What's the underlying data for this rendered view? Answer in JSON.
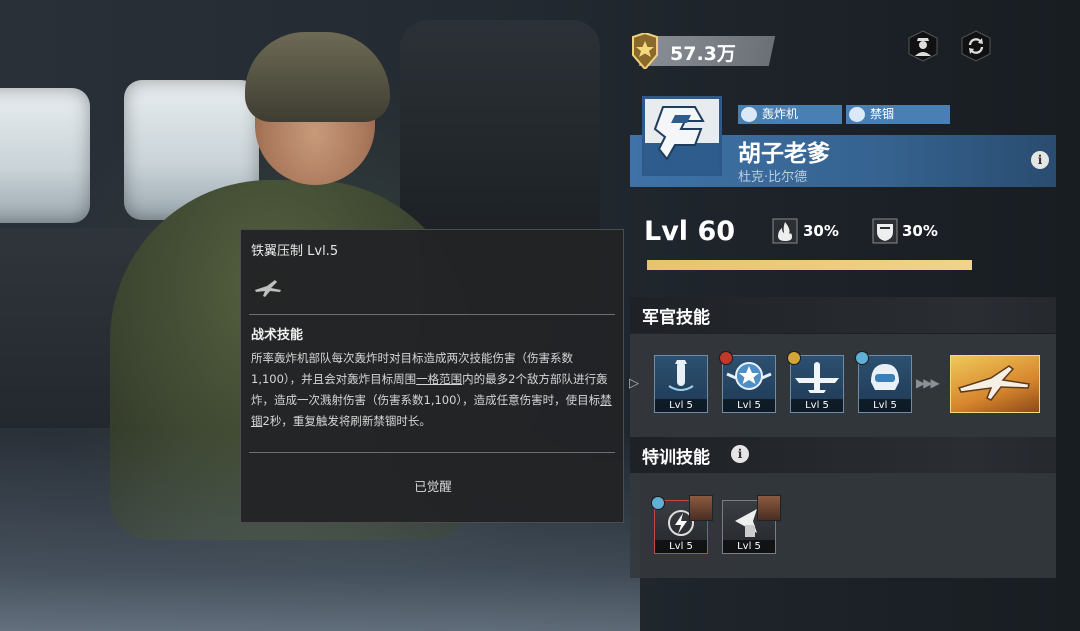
{
  "currency": {
    "amount": "57.3万"
  },
  "officer": {
    "tags": [
      "轰炸机",
      "禁锢"
    ],
    "name": "胡子老爹",
    "subname": "杜克·比尔德",
    "level": "Lvl 60",
    "stat1": "30%",
    "stat2": "30%",
    "xp_fraction": 1.0
  },
  "sections": {
    "officer_skills": "军官技能",
    "training_skills": "特训技能"
  },
  "skills": [
    {
      "level": "Lvl 5",
      "icon": "bomb-icon"
    },
    {
      "level": "Lvl 5",
      "icon": "star-wings-icon"
    },
    {
      "level": "Lvl 5",
      "icon": "plane-icon"
    },
    {
      "level": "Lvl 5",
      "icon": "pilot-helmet-icon"
    }
  ],
  "training": [
    {
      "level": "Lvl 5",
      "icon": "lightning-icon"
    },
    {
      "level": "Lvl 5",
      "icon": "shield-plane-icon"
    }
  ],
  "tooltip": {
    "title": "铁翼压制 Lvl.5",
    "section": "战术技能",
    "desc_part1": "所率轰炸机部队每次轰炸时对目标造成两次技能伤害（伤害系数1,100），并且会对轰炸目标周围",
    "desc_ul1": "一格范围",
    "desc_part2": "内的最多2个敌方部队进行轰炸，造成一次溅射伤害（伤害系数1,100），造成任意伤害时，使目标",
    "desc_ul2": "禁锢",
    "desc_part3": "2秒，重复触发将刷新禁锢时长。",
    "footer": "已觉醒"
  }
}
